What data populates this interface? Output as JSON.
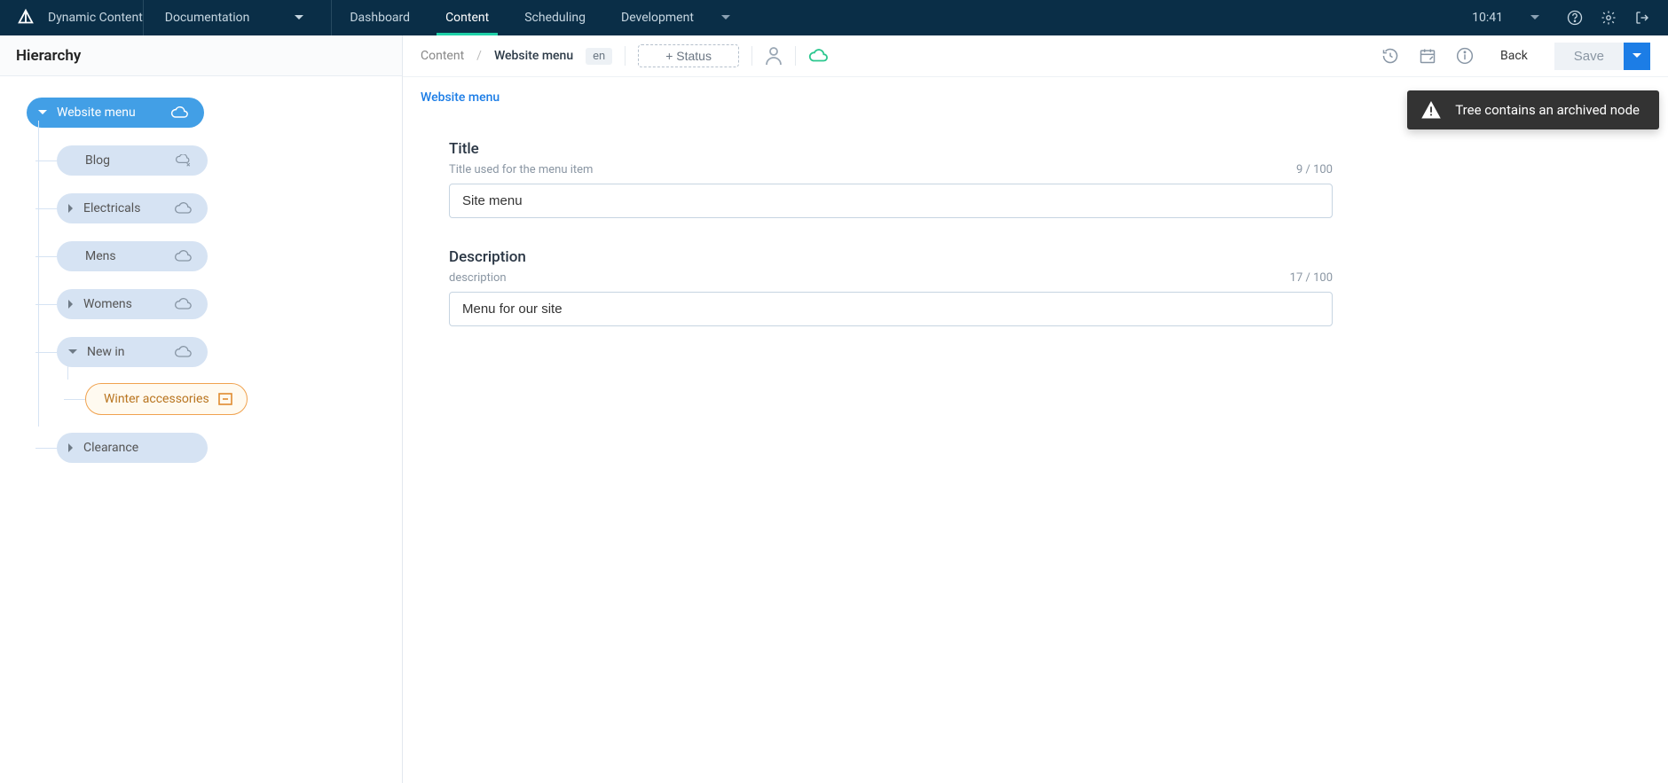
{
  "topnav": {
    "app_name": "Dynamic Content",
    "section_select": "Documentation",
    "tabs": [
      "Dashboard",
      "Content",
      "Scheduling",
      "Development"
    ],
    "active_tab_index": 1,
    "time": "10:41"
  },
  "sidebar": {
    "title": "Hierarchy",
    "root": {
      "label": "Website menu"
    },
    "children": [
      {
        "label": "Blog",
        "expandable": false,
        "status": "cloud-x"
      },
      {
        "label": "Electricals",
        "expandable": true,
        "status": "cloud"
      },
      {
        "label": "Mens",
        "expandable": false,
        "status": "cloud"
      },
      {
        "label": "Womens",
        "expandable": true,
        "status": "cloud"
      },
      {
        "label": "New in",
        "expandable": true,
        "expanded": true,
        "status": "cloud",
        "children": [
          {
            "label": "Winter accessories",
            "archived": true
          }
        ]
      },
      {
        "label": "Clearance",
        "expandable": true,
        "status": "none"
      }
    ]
  },
  "toolbar": {
    "crumb_section": "Content",
    "crumb_current": "Website menu",
    "lang": "en",
    "status_btn": "+ Status",
    "back": "Back",
    "save": "Save"
  },
  "form": {
    "section_heading": "Website menu",
    "title": {
      "label": "Title",
      "hint": "Title used for the menu item",
      "value": "Site menu",
      "counter": "9 / 100"
    },
    "description": {
      "label": "Description",
      "hint": "description",
      "value": "Menu for our site",
      "counter": "17 / 100"
    }
  },
  "toast": {
    "message": "Tree contains an archived node"
  }
}
